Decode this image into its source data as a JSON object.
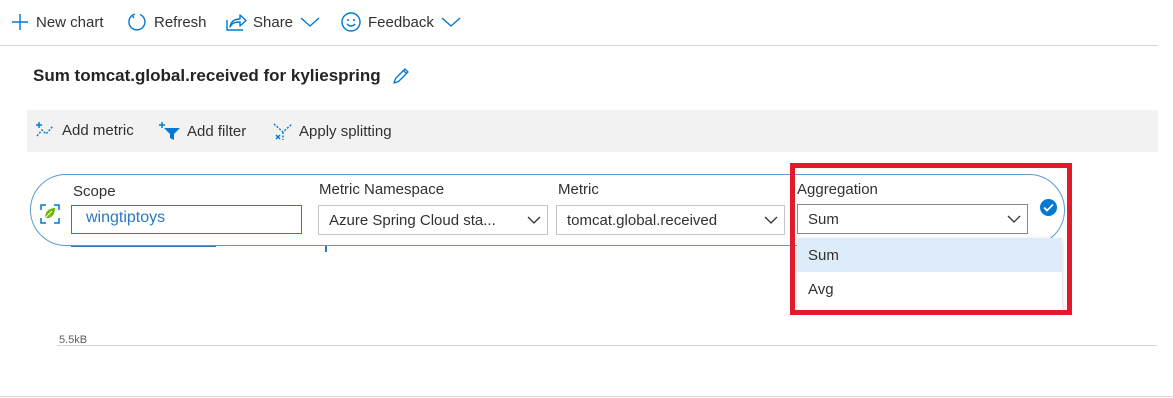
{
  "toolbar": {
    "new_chart": "New chart",
    "refresh": "Refresh",
    "share": "Share",
    "feedback": "Feedback"
  },
  "chart": {
    "title": "Sum tomcat.global.received for kyliespring"
  },
  "commands": {
    "add_metric": "Add metric",
    "add_filter": "Add filter",
    "apply_splitting": "Apply splitting"
  },
  "metric_row": {
    "scope_label": "Scope",
    "scope_value": "wingtiptoys",
    "namespace_label": "Metric Namespace",
    "namespace_value": "Azure Spring Cloud sta...",
    "metric_label": "Metric",
    "metric_value": "tomcat.global.received",
    "aggregation_label": "Aggregation",
    "aggregation_value": "Sum"
  },
  "aggregation_options": [
    "Sum",
    "Avg"
  ],
  "plot": {
    "y_tick": "5.5kB"
  },
  "colors": {
    "accent": "#0078d4",
    "link_blue": "#2b79c2",
    "highlight_red": "#e21b2a",
    "selected_bg": "#deecf9"
  },
  "icons": {
    "new_chart": "plus-icon",
    "refresh": "refresh-icon",
    "share": "share-icon",
    "feedback": "smiley-icon",
    "edit": "pencil-icon",
    "add_metric": "add-metric-icon",
    "add_filter": "add-filter-icon",
    "apply_splitting": "split-icon",
    "scope": "resource-icon",
    "confirm": "checkmark-icon"
  }
}
